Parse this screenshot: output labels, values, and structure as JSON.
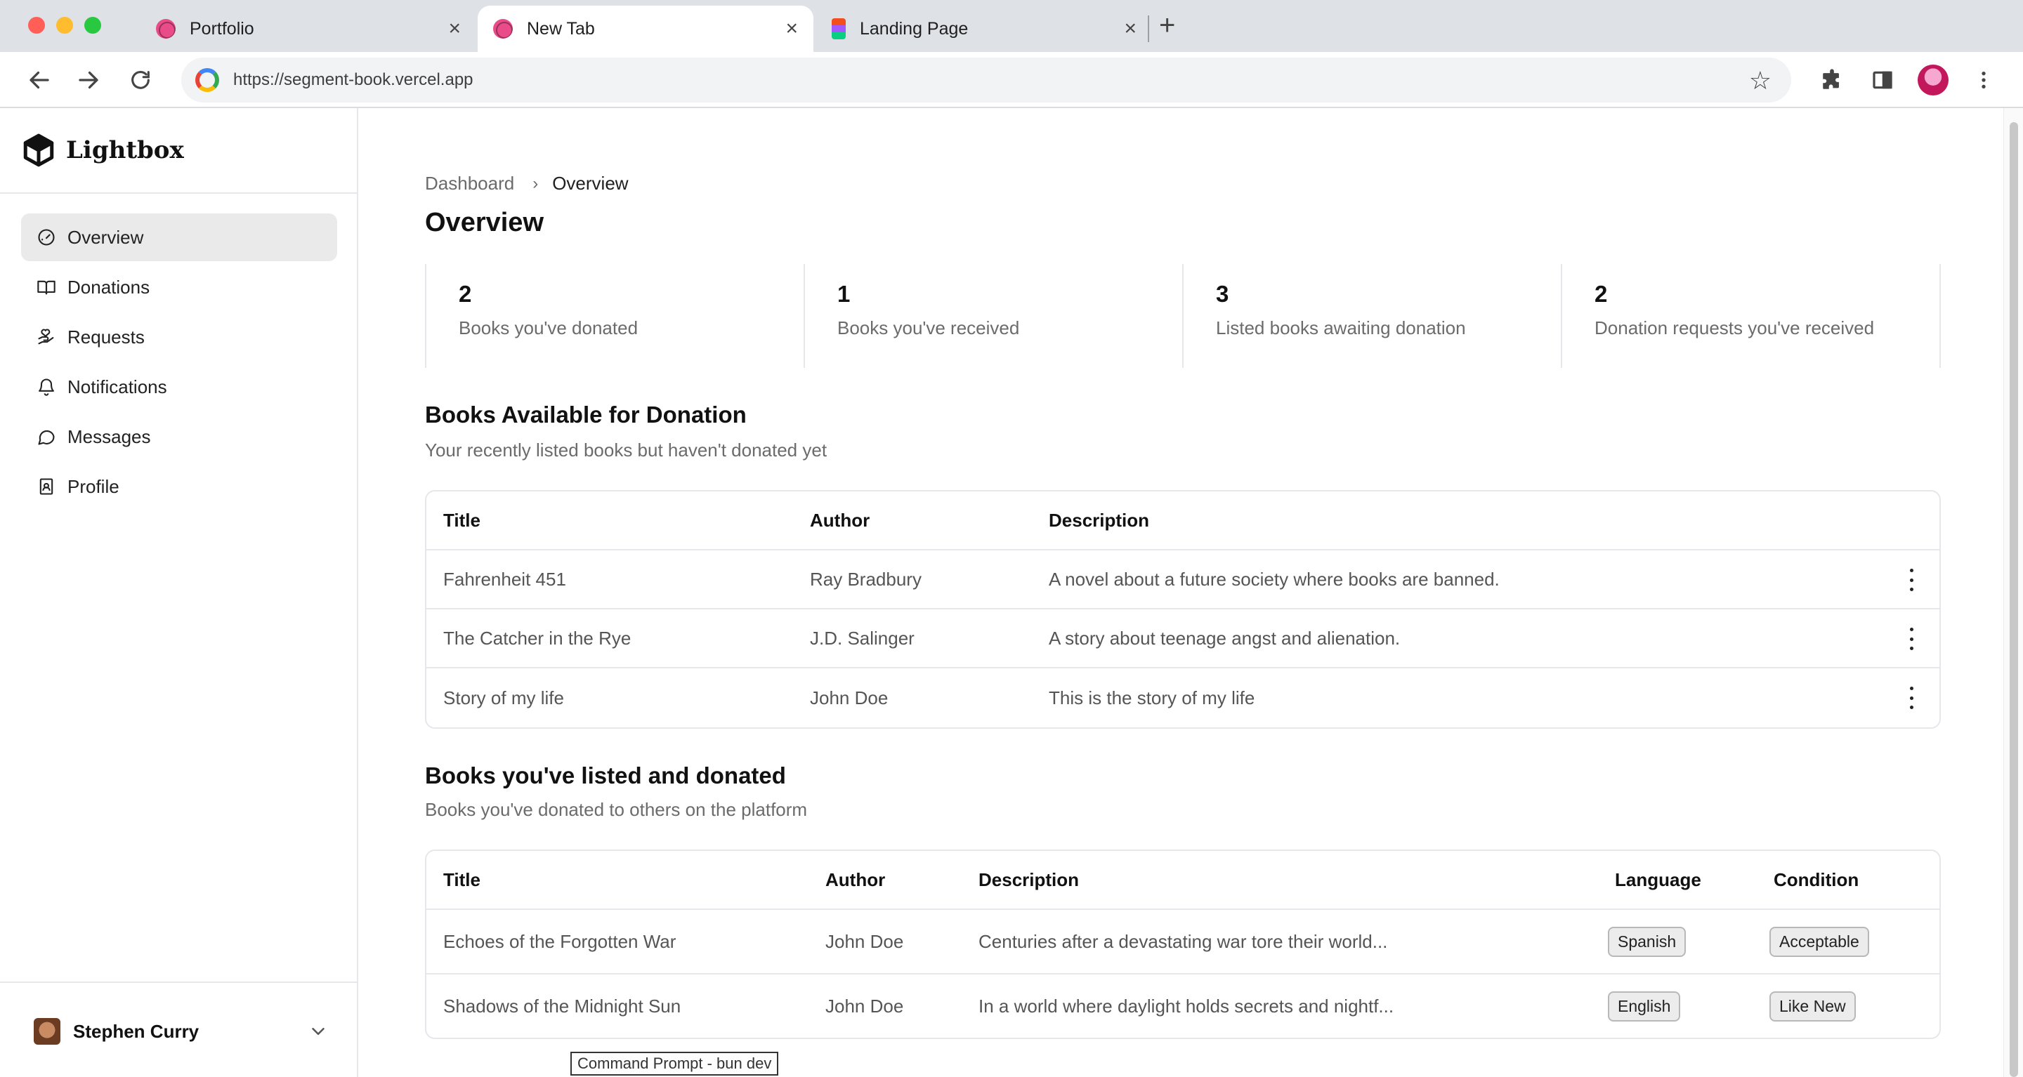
{
  "browser": {
    "tabs": [
      {
        "title": "Portfolio",
        "icon": "dribbble-icon",
        "active": false
      },
      {
        "title": "New Tab",
        "icon": "dribbble-icon",
        "active": true
      },
      {
        "title": "Landing Page",
        "icon": "figma-icon",
        "active": false
      }
    ],
    "url": "https://segment-book.vercel.app"
  },
  "sidebar": {
    "brand": "Lightbox",
    "items": [
      {
        "label": "Overview",
        "icon": "gauge-icon",
        "active": true
      },
      {
        "label": "Donations",
        "icon": "book-open-icon",
        "active": false
      },
      {
        "label": "Requests",
        "icon": "hand-heart-icon",
        "active": false
      },
      {
        "label": "Notifications",
        "icon": "bell-icon",
        "active": false
      },
      {
        "label": "Messages",
        "icon": "message-circle-icon",
        "active": false
      },
      {
        "label": "Profile",
        "icon": "contact-icon",
        "active": false
      }
    ],
    "user": {
      "name": "Stephen Curry"
    }
  },
  "main": {
    "breadcrumb": {
      "parent": "Dashboard",
      "separator": "›",
      "current": "Overview"
    },
    "title": "Overview",
    "stats": [
      {
        "value": "2",
        "label": "Books you've donated"
      },
      {
        "value": "1",
        "label": "Books you've received"
      },
      {
        "value": "3",
        "label": "Listed books awaiting donation"
      },
      {
        "value": "2",
        "label": "Donation requests you've received"
      }
    ],
    "available": {
      "title": "Books Available for Donation",
      "subtitle": "Your recently listed books but haven't donated yet",
      "headers": {
        "title": "Title",
        "author": "Author",
        "description": "Description"
      },
      "rows": [
        {
          "title": "Fahrenheit 451",
          "author": "Ray Bradbury",
          "description": "A novel about a future society where books are banned."
        },
        {
          "title": "The Catcher in the Rye",
          "author": "J.D. Salinger",
          "description": "A story about teenage angst and alienation."
        },
        {
          "title": "Story of my life",
          "author": "John Doe",
          "description": "This is the story of my life"
        }
      ]
    },
    "donated": {
      "title": "Books you've listed and donated",
      "subtitle": "Books you've donated to others on the platform",
      "headers": {
        "title": "Title",
        "author": "Author",
        "description": "Description",
        "language": "Language",
        "condition": "Condition"
      },
      "rows": [
        {
          "title": "Echoes of the Forgotten War",
          "author": "John Doe",
          "description": "Centuries after a devastating war tore their world...",
          "language": "Spanish",
          "condition": "Acceptable"
        },
        {
          "title": "Shadows of the Midnight Sun",
          "author": "John Doe",
          "description": "In a world where daylight holds secrets and nightf...",
          "language": "English",
          "condition": "Like New"
        }
      ]
    }
  },
  "tooltip": "Command Prompt - bun  dev"
}
